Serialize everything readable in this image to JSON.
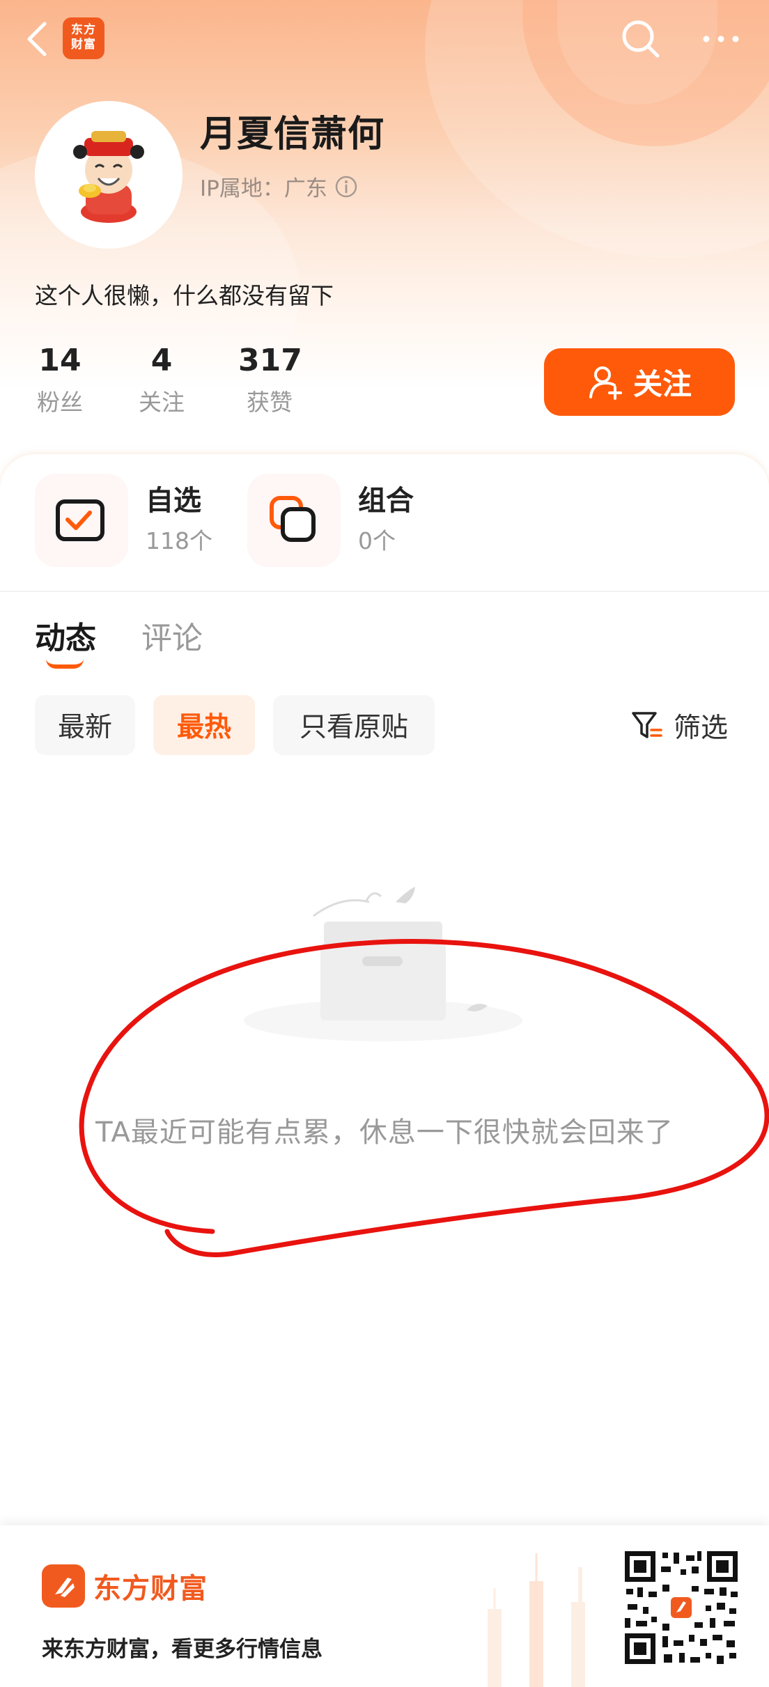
{
  "colors": {
    "accent": "#ff5a0a",
    "brand": "#f15a1f",
    "muted": "#999999",
    "hero_top": "#fbb58c"
  },
  "topbar": {
    "app_logo_line1": "东方",
    "app_logo_line2": "财富",
    "icons": [
      "back-icon",
      "search-icon",
      "more-icon"
    ]
  },
  "profile": {
    "username": "月夏信萧何",
    "ip_location": "IP属地：广东",
    "bio": "这个人很懒，什么都没有留下",
    "stats": [
      {
        "value": "14",
        "label": "粉丝"
      },
      {
        "value": "4",
        "label": "关注"
      },
      {
        "value": "317",
        "label": "获赞"
      }
    ],
    "follow_label": "关注"
  },
  "tiles": [
    {
      "title": "自选",
      "subtitle": "118个",
      "icon": "checkbox-icon"
    },
    {
      "title": "组合",
      "subtitle": "0个",
      "icon": "overlap-squares-icon"
    }
  ],
  "tabs": [
    {
      "label": "动态",
      "active": true
    },
    {
      "label": "评论",
      "active": false
    }
  ],
  "chips": [
    {
      "label": "最新",
      "active": false
    },
    {
      "label": "最热",
      "active": true
    },
    {
      "label": "只看原贴",
      "active": false
    }
  ],
  "filter_label": "筛选",
  "empty_message": "TA最近可能有点累，休息一下很快就会回来了",
  "footer": {
    "brand_name": "东方财富",
    "slogan": "来东方财富，看更多行情信息"
  }
}
